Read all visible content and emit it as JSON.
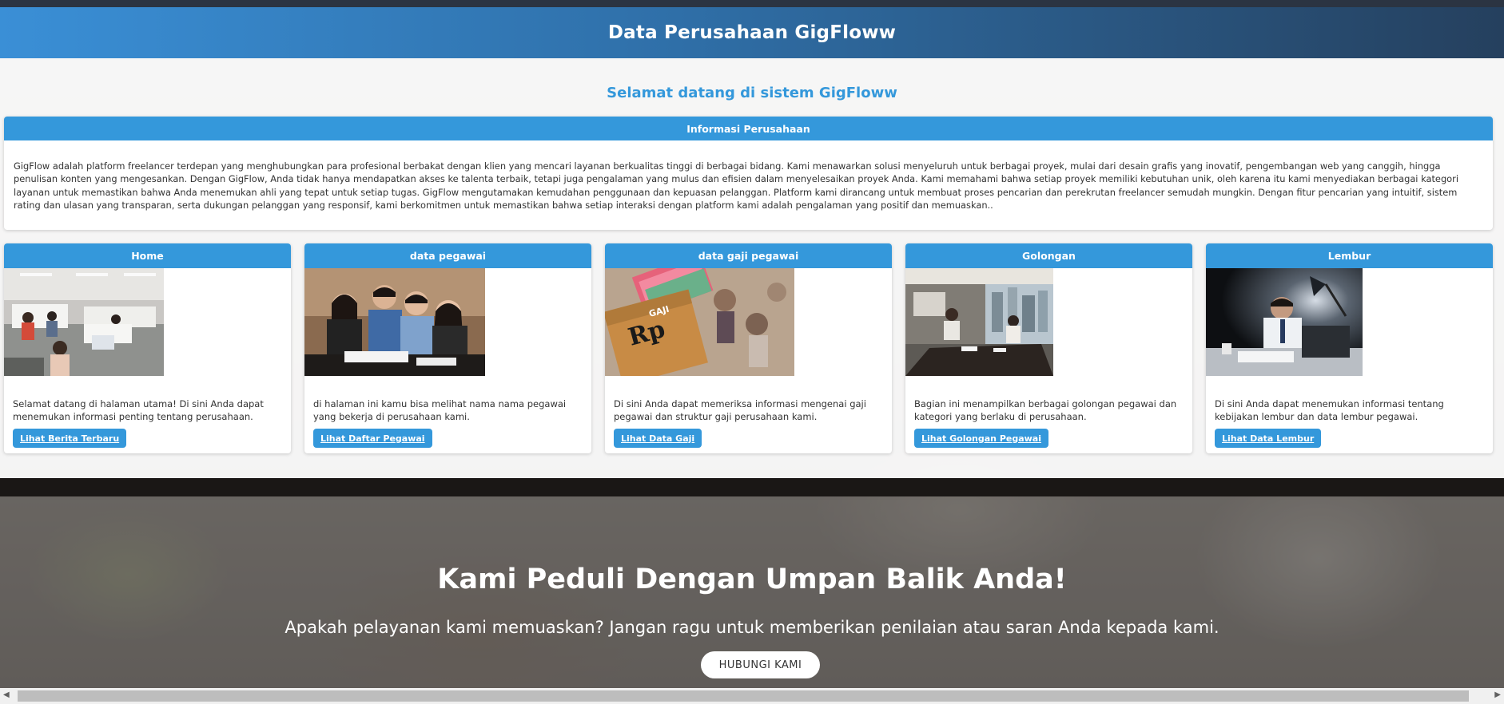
{
  "header": {
    "title": "Data Perusahaan GigFloww"
  },
  "welcome": "Selamat datang di sistem GigFloww",
  "info": {
    "title": "Informasi Perusahaan",
    "text": "GigFlow adalah platform freelancer terdepan yang menghubungkan para profesional berbakat dengan klien yang mencari layanan berkualitas tinggi di berbagai bidang. Kami menawarkan solusi menyeluruh untuk berbagai proyek, mulai dari desain grafis yang inovatif, pengembangan web yang canggih, hingga penulisan konten yang mengesankan. Dengan GigFlow, Anda tidak hanya mendapatkan akses ke talenta terbaik, tetapi juga pengalaman yang mulus dan efisien dalam menyelesaikan proyek Anda. Kami memahami bahwa setiap proyek memiliki kebutuhan unik, oleh karena itu kami menyediakan berbagai kategori layanan untuk memastikan bahwa Anda menemukan ahli yang tepat untuk setiap tugas. GigFlow mengutamakan kemudahan penggunaan dan kepuasan pelanggan. Platform kami dirancang untuk membuat proses pencarian dan perekrutan freelancer semudah mungkin. Dengan fitur pencarian yang intuitif, sistem rating dan ulasan yang transparan, serta dukungan pelanggan yang responsif, kami berkomitmen untuk memastikan bahwa setiap interaksi dengan platform kami adalah pengalaman yang positif dan memuaskan.."
  },
  "cards": [
    {
      "title": "Home",
      "desc": "Selamat datang di halaman utama! Di sini Anda dapat menemukan informasi penting tentang perusahaan.",
      "button": "Lihat Berita Terbaru",
      "image": "office-floor-photo"
    },
    {
      "title": "data pegawai",
      "desc": "di halaman ini kamu bisa melihat nama nama pegawai yang bekerja di perusahaan kami.",
      "button": "Lihat Daftar Pegawai",
      "image": "team-photo"
    },
    {
      "title": "data gaji pegawai",
      "desc": "Di sini Anda dapat memeriksa informasi mengenai gaji pegawai dan struktur gaji perusahaan kami.",
      "button": "Lihat Data Gaji",
      "image": "salary-envelope-photo",
      "image_text": {
        "envelope": "GAJI",
        "currency": "Rp"
      }
    },
    {
      "title": "Golongan",
      "desc": "Bagian ini menampilkan berbagai golongan pegawai dan kategori yang berlaku di perusahaan.",
      "button": "Lihat Golongan Pegawai",
      "image": "meeting-room-photo"
    },
    {
      "title": "Lembur",
      "desc": "Di sini Anda dapat menemukan informasi tentang kebijakan lembur dan data lembur pegawai.",
      "button": "Lihat Data Lembur",
      "image": "night-work-photo"
    }
  ],
  "feedback": {
    "title": "Kami Peduli Dengan Umpan Balik Anda!",
    "subtitle": "Apakah pelayanan kami memuaskan? Jangan ragu untuk memberikan penilaian atau saran Anda kepada kami.",
    "button": "HUBUNGI KAMI"
  },
  "colors": {
    "accent": "#3498db",
    "header_dark": "#25405e"
  },
  "icons": {
    "scroll_left": "scroll-left-arrow-icon",
    "scroll_right": "scroll-right-arrow-icon"
  }
}
